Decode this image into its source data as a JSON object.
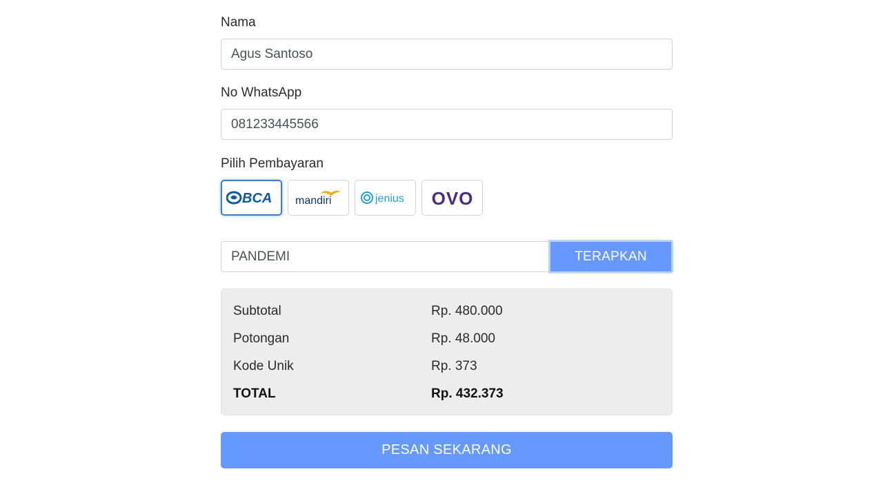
{
  "form": {
    "name_label": "Nama",
    "name_value": "Agus Santoso",
    "whatsapp_label": "No WhatsApp",
    "whatsapp_value": "081233445566",
    "payment_label": "Pilih Pembayaran"
  },
  "payment_methods": [
    {
      "name": "BCA",
      "icon": "bca-logo",
      "color": "#0b5aa6",
      "selected": true
    },
    {
      "name": "mandiri",
      "icon": "mandiri-logo",
      "color": "#12306b",
      "accent": "#f5a800",
      "selected": false
    },
    {
      "name": "jenius",
      "icon": "jenius-logo",
      "color": "#1fa3d5",
      "selected": false
    },
    {
      "name": "OVO",
      "icon": "ovo-logo",
      "color": "#4c2a86",
      "selected": false
    }
  ],
  "voucher": {
    "code": "PANDEMI",
    "apply_label": "TERAPKAN"
  },
  "summary": {
    "subtotal_label": "Subtotal",
    "subtotal_value": "Rp. 480.000",
    "discount_label": "Potongan",
    "discount_value": "Rp. 48.000",
    "unique_label": "Kode Unik",
    "unique_value": "Rp. 373",
    "total_label": "TOTAL",
    "total_value": "Rp. 432.373"
  },
  "order_button": "PESAN SEKARANG",
  "colors": {
    "primary": "#6699ff",
    "summary_bg": "#ededed",
    "selected_border": "#3b82c4"
  }
}
